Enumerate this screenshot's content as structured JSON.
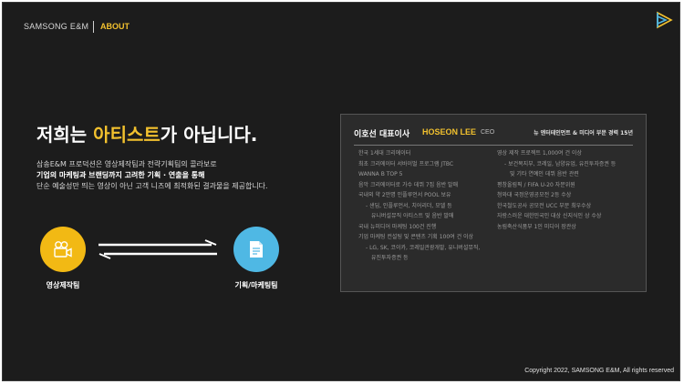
{
  "header": {
    "brand": "SAMSONG E&M",
    "nav_about": "ABOUT",
    "logo_icon": "play-triangle-logo-icon"
  },
  "hero": {
    "headline_pre": "저희는 ",
    "headline_highlight": "아티스트",
    "headline_post": "가 아닙니다.",
    "line1": "삼송E&M 프로덕션은 영상제작팀과 전략기획팀의 콜라보로",
    "line2": "기업의 마케팅과 브랜딩까지 고려한 기획 · 연출을 통해",
    "line3": "단순 예술성만 띄는 영상이 아닌 고객 니즈에 최적화된 결과물을 제공합니다."
  },
  "teams": {
    "left_label": "영상제작팀",
    "right_label": "기획/마케팅팀",
    "left_icon": "camera-icon",
    "right_icon": "document-icon",
    "colors": {
      "left": "#f2b914",
      "right": "#4fb8e4"
    }
  },
  "profile": {
    "name": "이호선 대표이사",
    "english_name": "HOSEON LEE",
    "role": "CEO",
    "tagline": "뉴 엔터테인먼트 & 미디어 부문 경력 15년",
    "left_items": [
      "한국 1세대 크리에이터",
      "최초 크리에이터 서바이벌 프로그램 JTBC",
      "WANNA B TOP 5",
      "음악 크리에이터로 가수 데뷔 7집 음반 발매",
      "국내외 약 2만명 인플루언서 POOL 보유",
      "- 샌딥, 인플루언서, 치어리더, 모델 등",
      "유니버설뮤직 아티스트 및 음반 발매",
      "국내 뉴미디어 마케팅 100건 진행",
      "기업 마케팅 컨설팅 및 콘텐츠 기획 100여 건 이상",
      "- LG, SK, 코이카, 코레일관광개발, 유니버설뮤직,",
      "유진투자증권 등"
    ],
    "right_items": [
      "영상 제작 프로젝트 1,000여 건 이상",
      "- 보건복지부, 코레일, 남양유업, 유진투자증권 등",
      "및 기타 연예인 데뷔 음반 관련",
      "평창올림픽 / FIFA U-20 자문위원",
      "청와대 국정운영공모전 2등 수상",
      "한국철도공사 공모전 UCC 부문 최우수상",
      "자랑스러운 대한민국인 대상 신지식인 상 수상",
      "농림축산식품부 1인 미디어 장관상"
    ]
  },
  "footer": {
    "copyright": "Copyright 2022, SAMSONG E&M, All rights reserved"
  }
}
